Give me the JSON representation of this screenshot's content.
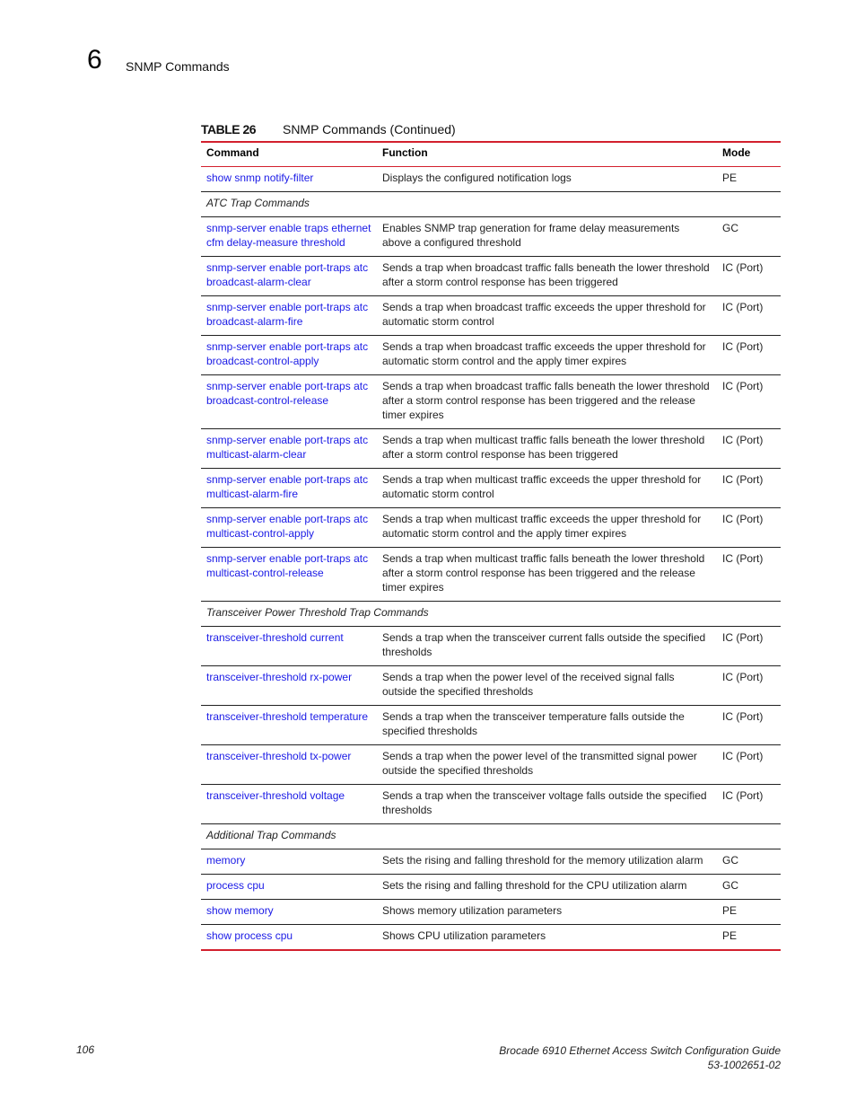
{
  "header": {
    "chapter_number": "6",
    "chapter_title": "SNMP Commands"
  },
  "table": {
    "label": "TABLE 26",
    "title": "SNMP Commands (Continued)",
    "columns": [
      "Command",
      "Function",
      "Mode"
    ],
    "accent_color": "#d3202e",
    "link_color": "#1a1ae6",
    "rows": [
      {
        "type": "row",
        "command": "show snmp notify-filter",
        "function": "Displays the configured notification logs",
        "mode": "PE"
      },
      {
        "type": "section",
        "label": "ATC Trap Commands"
      },
      {
        "type": "row",
        "command": "snmp-server enable traps ethernet cfm delay-measure threshold",
        "function": "Enables SNMP trap generation for frame delay measurements above a configured threshold",
        "mode": "GC"
      },
      {
        "type": "row",
        "command": "snmp-server enable port-traps atc broadcast-alarm-clear",
        "function": "Sends a trap when broadcast traffic falls beneath the lower threshold after a storm control response has been triggered",
        "mode": "IC (Port)"
      },
      {
        "type": "row",
        "command": "snmp-server enable port-traps atc broadcast-alarm-fire",
        "function": "Sends a trap when broadcast traffic exceeds the upper threshold for automatic storm control",
        "mode": "IC (Port)"
      },
      {
        "type": "row",
        "command": "snmp-server enable port-traps atc broadcast-control-apply",
        "function": "Sends a trap when broadcast traffic exceeds the upper threshold for automatic storm control and the apply timer expires",
        "mode": "IC (Port)"
      },
      {
        "type": "row",
        "command": "snmp-server enable port-traps atc broadcast-control-release",
        "function": "Sends a trap when broadcast traffic falls beneath the lower threshold after a storm control response has been triggered and the release timer expires",
        "mode": "IC (Port)"
      },
      {
        "type": "row",
        "command": "snmp-server enable port-traps atc multicast-alarm-clear",
        "function": "Sends a trap when multicast traffic falls beneath the lower threshold after a storm control response has been triggered",
        "mode": "IC (Port)"
      },
      {
        "type": "row",
        "command": "snmp-server enable port-traps atc multicast-alarm-fire",
        "function": "Sends a trap when multicast traffic exceeds the upper threshold for automatic storm control",
        "mode": "IC (Port)"
      },
      {
        "type": "row",
        "command": "snmp-server enable port-traps atc multicast-control-apply",
        "function": "Sends a trap when multicast traffic exceeds the upper threshold for automatic storm control and the apply timer expires",
        "mode": "IC (Port)"
      },
      {
        "type": "row",
        "command": "snmp-server enable port-traps atc multicast-control-release",
        "function": "Sends a trap when multicast traffic falls beneath the lower threshold after a storm control response has been triggered and the release timer expires",
        "mode": "IC (Port)"
      },
      {
        "type": "section",
        "label": "Transceiver Power Threshold Trap Commands"
      },
      {
        "type": "row",
        "command": "transceiver-threshold current",
        "function": "Sends a trap when the transceiver current falls outside the specified thresholds",
        "mode": "IC (Port)"
      },
      {
        "type": "row",
        "command": "transceiver-threshold rx-power",
        "function": "Sends a trap when the power level of the received signal falls outside the specified thresholds",
        "mode": "IC (Port)"
      },
      {
        "type": "row",
        "command": "transceiver-threshold temperature",
        "function": "Sends a trap when the transceiver temperature falls outside the specified thresholds",
        "mode": "IC (Port)"
      },
      {
        "type": "row",
        "command": "transceiver-threshold tx-power",
        "function": "Sends a trap when the power level of the transmitted signal power outside the specified thresholds",
        "mode": "IC (Port)"
      },
      {
        "type": "row",
        "command": "transceiver-threshold voltage",
        "function": "Sends a trap when the transceiver voltage falls outside the specified thresholds",
        "mode": "IC (Port)"
      },
      {
        "type": "section",
        "label": "Additional Trap Commands"
      },
      {
        "type": "row",
        "command": "memory",
        "function": "Sets the rising and falling threshold for the memory utilization alarm",
        "mode": "GC"
      },
      {
        "type": "row",
        "command": "process cpu",
        "function": "Sets the rising and falling threshold for the CPU utilization alarm",
        "mode": "GC"
      },
      {
        "type": "row",
        "command": "show memory",
        "function": "Shows memory utilization parameters",
        "mode": "PE"
      },
      {
        "type": "row",
        "command": "show process cpu",
        "function": "Shows CPU utilization parameters",
        "mode": "PE"
      }
    ]
  },
  "footer": {
    "page_number": "106",
    "doc_title": "Brocade 6910 Ethernet Access Switch Configuration Guide",
    "doc_number": "53-1002651-02"
  }
}
